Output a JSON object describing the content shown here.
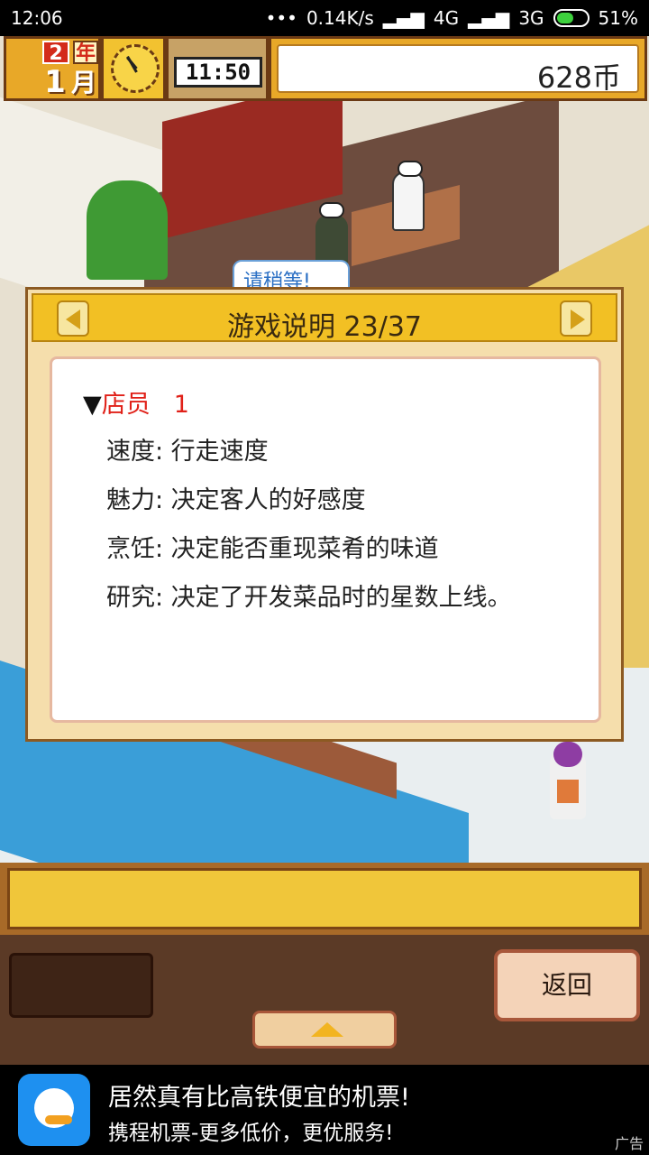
{
  "status_bar": {
    "time": "12:06",
    "dots": "•••",
    "net_speed": "0.14K/s",
    "net1": "4G",
    "net2": "3G",
    "battery": "51%"
  },
  "hud": {
    "year_num": "2",
    "year_label": "年",
    "month_num": "1",
    "month_label": "月",
    "clock_time": "11:50",
    "money": "628币"
  },
  "scene": {
    "speech_bubble": "请稍等!"
  },
  "dialog": {
    "title": "游戏说明 23/37",
    "heading_marker": "▼",
    "heading": "店员",
    "heading_num": "1",
    "rows": [
      "速度: 行走速度",
      "魅力: 决定客人的好感度",
      "烹饪: 决定能否重现菜肴的味道",
      "研究: 决定了开发菜品时的星数上线。"
    ]
  },
  "controls": {
    "back_label": "返回"
  },
  "ad": {
    "title": "居然真有比高铁便宜的机票!",
    "subtitle": "携程机票-更多低价，更优服务!",
    "tag": "广告"
  },
  "colors": {
    "accent": "#f2c024",
    "heading": "#e02018",
    "panel": "#5b3a26"
  }
}
